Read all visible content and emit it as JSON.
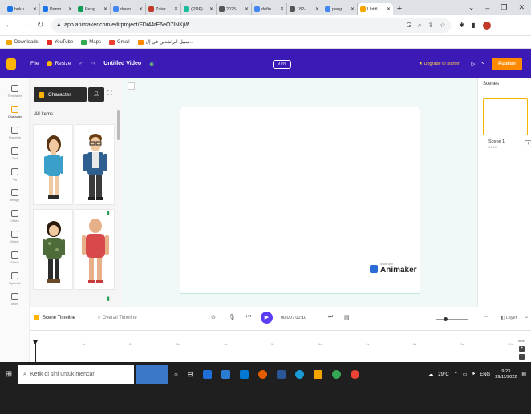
{
  "browser": {
    "tabs": [
      {
        "label": "buku",
        "color": "#1a73e8"
      },
      {
        "label": "Pemb",
        "color": "#1a73e8"
      },
      {
        "label": "Peng",
        "color": "#0f9d58"
      },
      {
        "label": "down",
        "color": "#4285f4"
      },
      {
        "label": "Zoter",
        "color": "#c0392b"
      },
      {
        "label": "(PDF)",
        "color": "#1abc9c"
      },
      {
        "label": "2025-",
        "color": "#555555"
      },
      {
        "label": "defin",
        "color": "#4285f4"
      },
      {
        "label": "182-",
        "color": "#555555"
      },
      {
        "label": "peng",
        "color": "#4285f4"
      },
      {
        "label": "Untitl",
        "color": "#f5a500",
        "active": true
      }
    ],
    "new_tab": "+",
    "url": "app.animaker.com/editproject/FDi44rE6eO7INKjW",
    "bookmarks": [
      {
        "label": "Downloads",
        "color": "#f5a500"
      },
      {
        "label": "YouTube",
        "color": "#e52d27"
      },
      {
        "label": "Maps",
        "color": "#34a853"
      },
      {
        "label": "Gmail",
        "color": "#ea4335"
      },
      {
        "label": "سبيل الراشدين في إل...",
        "color": "#ff8a00"
      }
    ]
  },
  "app": {
    "menu": {
      "file": "File",
      "resize": "Resize",
      "title": "Untitled Video"
    },
    "zoom": "97%",
    "upgrade": "Upgrade to starter",
    "publish": "Publish",
    "sidebar": [
      {
        "label": "Templates"
      },
      {
        "label": "Character",
        "active": true
      },
      {
        "label": "Property"
      },
      {
        "label": "Text"
      },
      {
        "label": "Bg"
      },
      {
        "label": "Image"
      },
      {
        "label": "Video"
      },
      {
        "label": "Music"
      },
      {
        "label": "Effect"
      },
      {
        "label": "Uploads"
      },
      {
        "label": "More"
      }
    ],
    "panel": {
      "character_btn": "Character",
      "all_items": "All Items"
    },
    "scenes": {
      "header": "Scenes",
      "scene_name": "Scene 1",
      "scene_time": "00:10"
    },
    "watermark": {
      "small": "Made with",
      "big": "Animaker"
    },
    "timeline": {
      "scene_timeline": "Scene Timeline",
      "overall_timeline": "Overall Timeline",
      "time": "00:00 / 00:10",
      "layer": "Layer",
      "ticks": [
        "1s",
        "2s",
        "3s",
        "4s",
        "5s",
        "6s",
        "7s",
        "8s",
        "9s",
        "10s"
      ],
      "time_label": "Time"
    }
  },
  "taskbar": {
    "search_placeholder": "Ketik di sini untuk mencari",
    "weather": "29°C",
    "lang": "ENG",
    "time": "9:23",
    "date": "29/11/2022"
  }
}
